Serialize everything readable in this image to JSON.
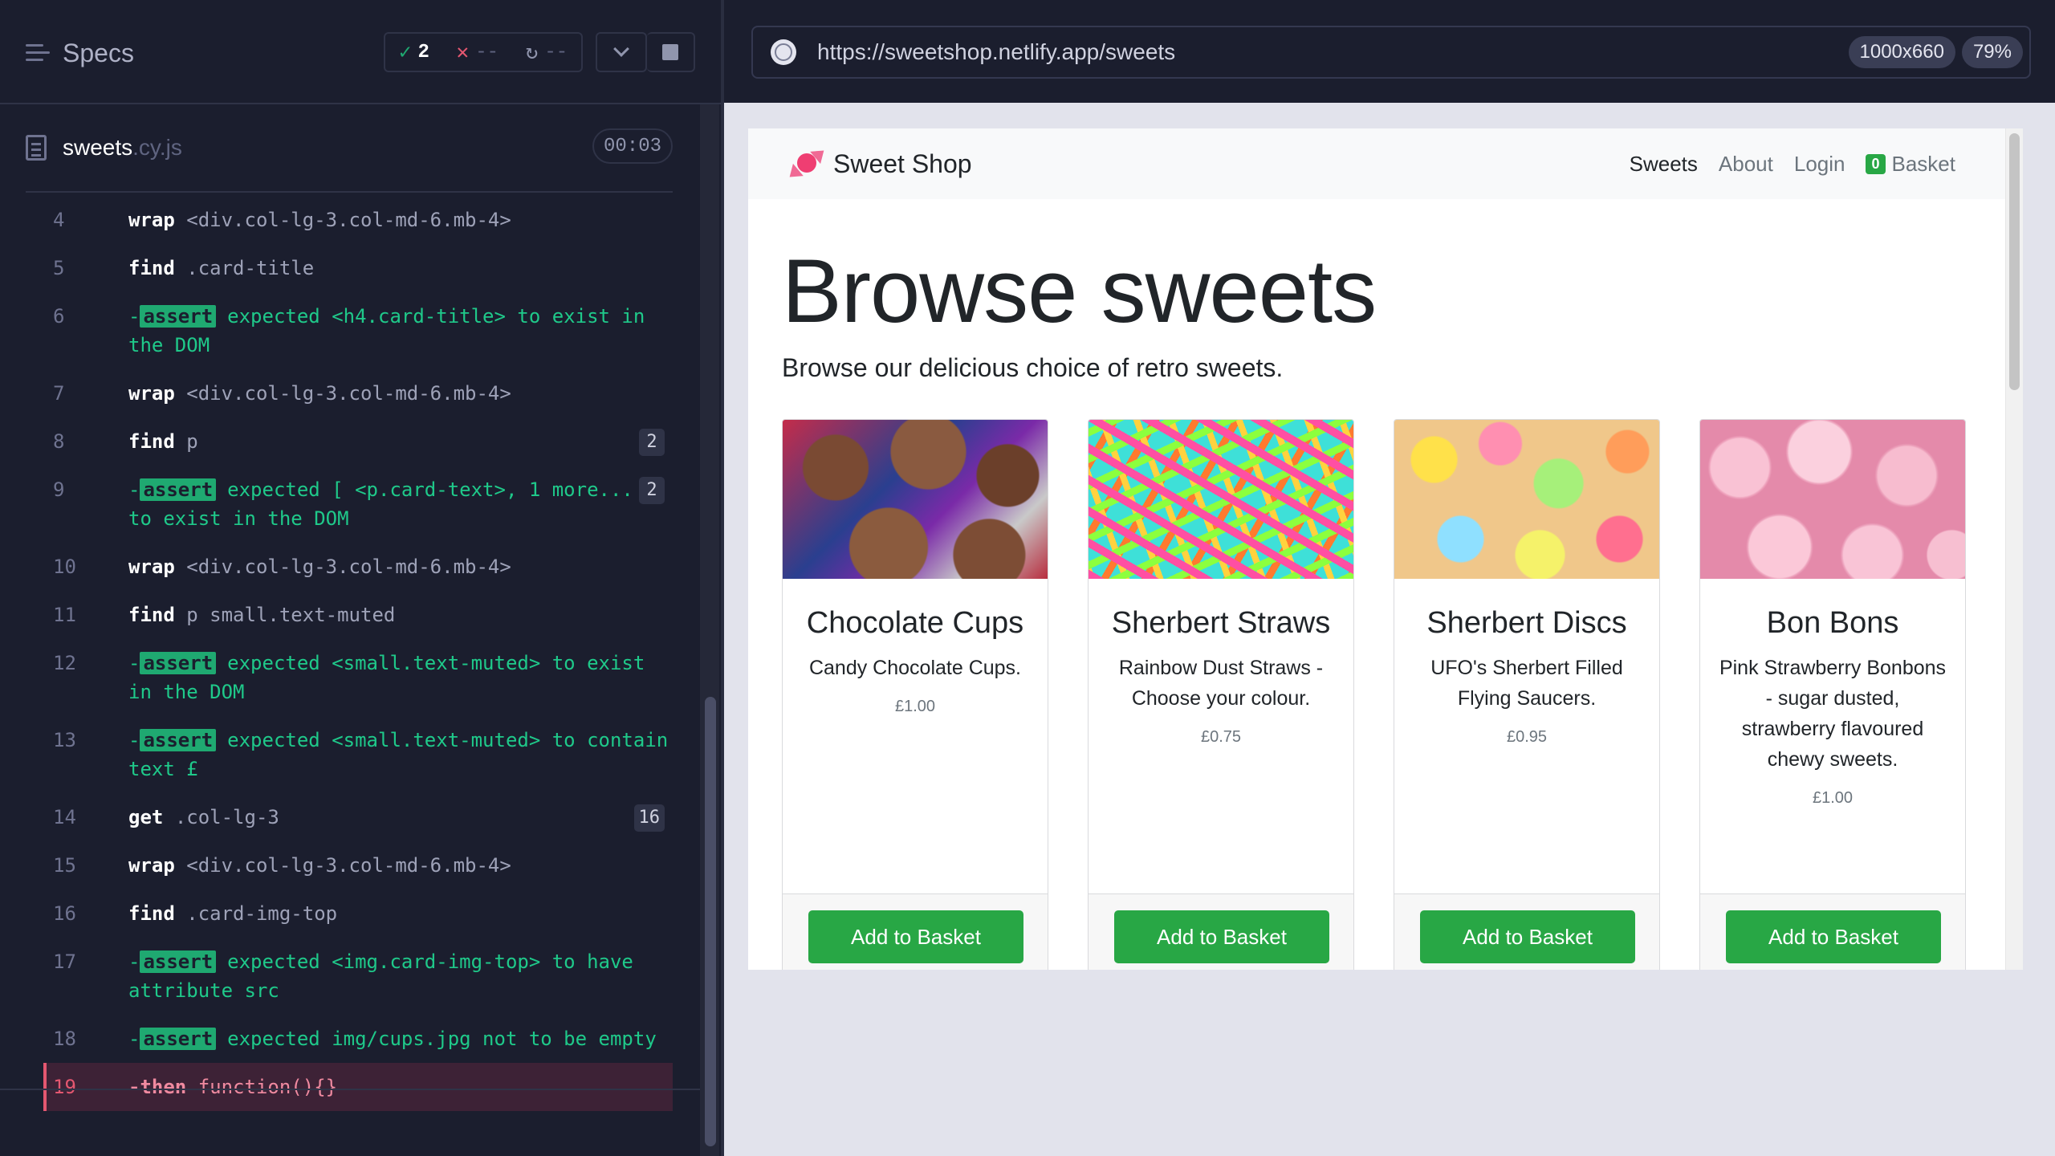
{
  "reporter": {
    "title": "Specs",
    "stats": {
      "passed": "2",
      "failed": "--",
      "pending": "--"
    },
    "file": {
      "name": "sweets",
      "ext": ".cy.js",
      "time": "00:03"
    },
    "commands": [
      {
        "num": "4",
        "name": "wrap",
        "msg": "<div.col-lg-3.col-md-6.mb-4>",
        "type": "cmd"
      },
      {
        "num": "5",
        "name": "find",
        "msg": ".card-title",
        "type": "cmd"
      },
      {
        "num": "6",
        "tag": "assert",
        "msg": "expected <h4.card-title> to exist in the DOM",
        "type": "assert"
      },
      {
        "num": "7",
        "name": "wrap",
        "msg": "<div.col-lg-3.col-md-6.mb-4>",
        "type": "cmd"
      },
      {
        "num": "8",
        "name": "find",
        "msg": "p",
        "badge": "2",
        "type": "cmd"
      },
      {
        "num": "9",
        "tag": "assert",
        "msg": "expected [ <p.card-text>, 1 more... ] to exist in the DOM",
        "badge": "2",
        "type": "assert"
      },
      {
        "num": "10",
        "name": "wrap",
        "msg": "<div.col-lg-3.col-md-6.mb-4>",
        "type": "cmd"
      },
      {
        "num": "11",
        "name": "find",
        "msg": "p small.text-muted",
        "type": "cmd"
      },
      {
        "num": "12",
        "tag": "assert",
        "msg": "expected <small.text-muted> to exist in the DOM",
        "type": "assert"
      },
      {
        "num": "13",
        "tag": "assert",
        "msg": "expected <small.text-muted> to contain text £",
        "type": "assert"
      },
      {
        "num": "14",
        "name": "get",
        "msg": ".col-lg-3",
        "badge": "16",
        "type": "cmd"
      },
      {
        "num": "15",
        "name": "wrap",
        "msg": "<div.col-lg-3.col-md-6.mb-4>",
        "type": "cmd"
      },
      {
        "num": "16",
        "name": "find",
        "msg": ".card-img-top",
        "type": "cmd"
      },
      {
        "num": "17",
        "tag": "assert",
        "msg": "expected <img.card-img-top> to have attribute src",
        "type": "assert"
      },
      {
        "num": "18",
        "tag": "assert",
        "msg": "expected img/cups.jpg not to be empty",
        "type": "assert"
      },
      {
        "num": "19",
        "name": "-then",
        "msg": "function(){}",
        "type": "failed"
      }
    ]
  },
  "browser": {
    "url": "https://sweetshop.netlify.app/sweets",
    "viewport": "1000x660",
    "zoom": "79%"
  },
  "app": {
    "brand": "Sweet Shop",
    "nav": {
      "sweets": "Sweets",
      "about": "About",
      "login": "Login",
      "basket_count": "0",
      "basket": "Basket"
    },
    "hero_title": "Browse sweets",
    "hero_lead": "Browse our delicious choice of retro sweets.",
    "add_label": "Add to Basket",
    "products": [
      {
        "title": "Chocolate Cups",
        "text": "Candy Chocolate Cups.",
        "price": "£1.00"
      },
      {
        "title": "Sherbert Straws",
        "text": "Rainbow Dust Straws - Choose your colour.",
        "price": "£0.75"
      },
      {
        "title": "Sherbert Discs",
        "text": "UFO's Sherbert Filled Flying Saucers.",
        "price": "£0.95"
      },
      {
        "title": "Bon Bons",
        "text": "Pink Strawberry Bonbons - sugar dusted, strawberry flavoured chewy sweets.",
        "price": "£1.00"
      }
    ]
  }
}
